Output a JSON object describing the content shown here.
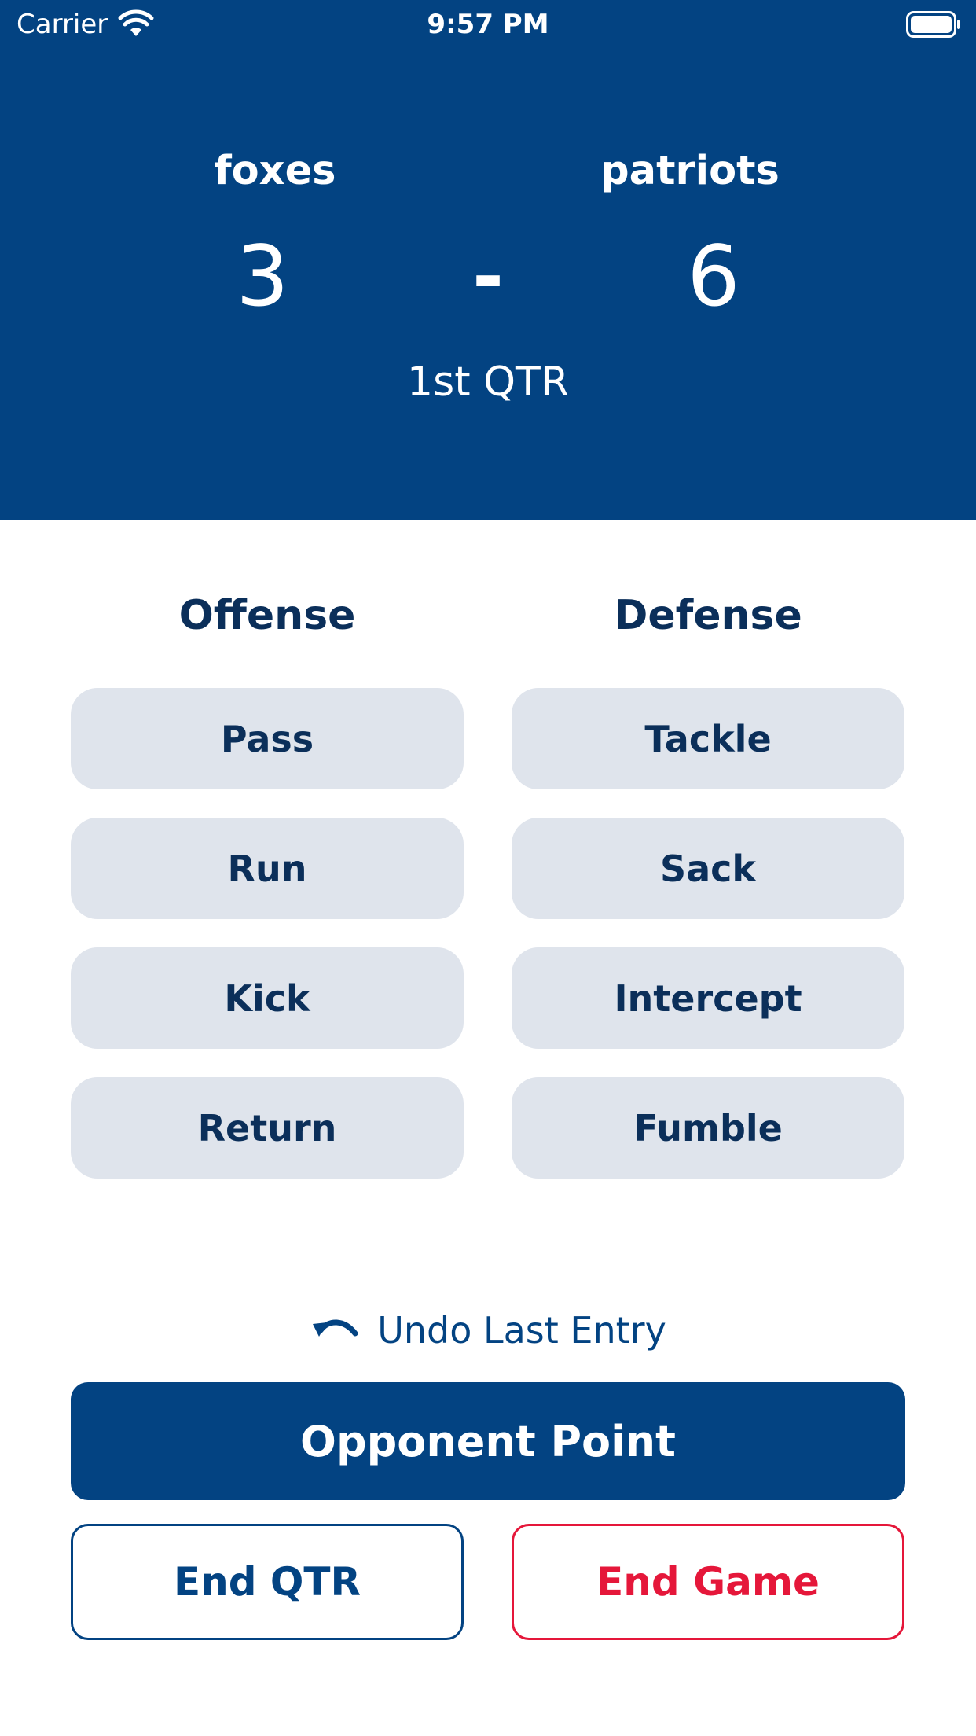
{
  "status_bar": {
    "carrier": "Carrier",
    "time": "9:57 PM",
    "wifi_icon": "wifi-icon",
    "battery_icon": "battery-icon"
  },
  "scoreboard": {
    "home_team": "foxes",
    "away_team": "patriots",
    "home_score": "3",
    "away_score": "6",
    "separator": "-",
    "quarter": "1st QTR"
  },
  "offense": {
    "heading": "Offense",
    "buttons": [
      "Pass",
      "Run",
      "Kick",
      "Return"
    ]
  },
  "defense": {
    "heading": "Defense",
    "buttons": [
      "Tackle",
      "Sack",
      "Intercept",
      "Fumble"
    ]
  },
  "controls": {
    "undo_label": "Undo Last Entry",
    "undo_icon": "undo-arrow-icon",
    "opponent_point_label": "Opponent Point",
    "end_qtr_label": "End QTR",
    "end_game_label": "End Game"
  },
  "colors": {
    "primary": "#034382",
    "button_bg": "#dfe4ec",
    "text_dark": "#0b2f5a",
    "danger": "#e5173a"
  }
}
